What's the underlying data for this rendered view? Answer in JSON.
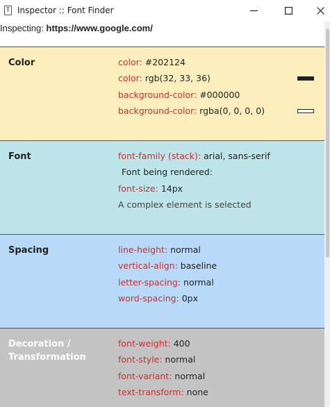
{
  "window": {
    "title": "Inspector :: Font Finder",
    "app_icon_glyph": "T"
  },
  "inspecting": {
    "label": "Inspecting:",
    "url": "https://www.google.com/"
  },
  "sections": {
    "color": {
      "title": "Color",
      "bg": "#fdeebd",
      "rows": [
        {
          "prop": "color:",
          "val": "#202124"
        },
        {
          "prop": "color:",
          "val": "rgb(32, 33, 36)",
          "swatch": "#202124"
        },
        {
          "prop": "background-color:",
          "val": "#000000"
        },
        {
          "prop": "background-color:",
          "val": "rgba(0, 0, 0, 0)",
          "swatch": "#ffffff"
        }
      ]
    },
    "font": {
      "title": "Font",
      "bg": "#bee5e9",
      "family_prop": "font-family (stack):",
      "family_val": "arial, sans-serif",
      "rendered_label": "Font being rendered:",
      "size_prop": "font-size:",
      "size_val": "14px",
      "note": "A complex element is selected"
    },
    "spacing": {
      "title": "Spacing",
      "bg": "#b8d9f8",
      "rows": [
        {
          "prop": "line-height:",
          "val": "normal"
        },
        {
          "prop": "vertical-align:",
          "val": "baseline"
        },
        {
          "prop": "letter-spacing:",
          "val": "normal"
        },
        {
          "prop": "word-spacing:",
          "val": "0px"
        }
      ]
    },
    "decoration": {
      "title_line1": "Decoration /",
      "title_line2": "Transformation",
      "bg": "#c4c4c4",
      "rows": [
        {
          "prop": "font-weight:",
          "val": "400"
        },
        {
          "prop": "font-style:",
          "val": "normal"
        },
        {
          "prop": "font-variant:",
          "val": "normal"
        },
        {
          "prop": "text-transform:",
          "val": "none"
        }
      ]
    }
  },
  "icons": {
    "minimize": "minimize-icon",
    "maximize": "maximize-icon",
    "close": "close-icon"
  }
}
